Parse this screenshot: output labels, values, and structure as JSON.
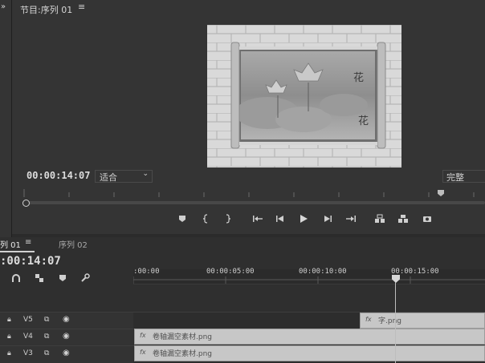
{
  "monitor": {
    "title": "节目:序列 01",
    "menu_icon": "≡",
    "collapse_icon": "»",
    "timecode": "00:00:14:07",
    "fit_select": "适合",
    "quality_select": "完整"
  },
  "transport": {
    "icons": [
      "marker-icon",
      "mark-in-icon",
      "mark-out-icon",
      "go-to-in-icon",
      "step-back-icon",
      "play-icon",
      "step-forward-icon",
      "go-to-out-icon",
      "lift-icon",
      "extract-icon",
      "export-frame-icon"
    ]
  },
  "timeline": {
    "tab_active": "列 01",
    "tab_menu_icon": "≡",
    "tab_inactive": "序列 02",
    "timecode": ":00:14:07",
    "ruler": [
      ":00:00",
      "00:00:05:00",
      "00:00:10:00",
      "00:00:15:00"
    ],
    "tracks": [
      {
        "name": "V5",
        "clip": "字.png"
      },
      {
        "name": "V4",
        "clip": "卷轴漏空素材.png"
      },
      {
        "name": "V3",
        "clip": "卷轴漏空素材.png"
      }
    ],
    "clip_fx_label": "fx"
  },
  "colors": {
    "accent": "#d0d0d0",
    "panel": "#343434",
    "timeline": "#2f2f2f",
    "clip": "#c7c7c7"
  }
}
